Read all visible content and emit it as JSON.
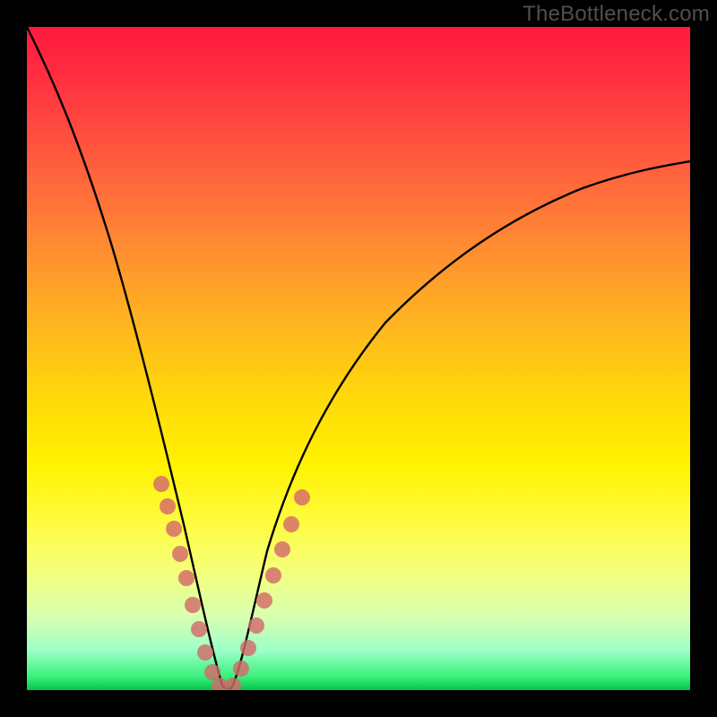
{
  "watermark": "TheBottleneck.com",
  "chart_data": {
    "type": "line",
    "title": "",
    "xlabel": "",
    "ylabel": "",
    "xlim": [
      0,
      100
    ],
    "ylim": [
      0,
      100
    ],
    "series": [
      {
        "name": "bottleneck-curve",
        "x": [
          0,
          5,
          10,
          15,
          18,
          20,
          22,
          24,
          26,
          28,
          29,
          30,
          31,
          32,
          34,
          36,
          40,
          45,
          50,
          55,
          60,
          65,
          70,
          75,
          80,
          85,
          90,
          95,
          100
        ],
        "y": [
          100,
          85,
          70,
          52,
          40,
          31,
          22,
          14,
          7,
          2,
          0.5,
          0,
          0.5,
          3,
          8,
          14,
          26,
          38,
          47,
          55,
          61,
          66,
          70,
          73,
          75,
          77,
          78.5,
          79.5,
          80
        ]
      },
      {
        "name": "marker-dots",
        "x": [
          20,
          21,
          22,
          23,
          24,
          25,
          26,
          27,
          28,
          29,
          31,
          32,
          33,
          34,
          35,
          36,
          37
        ],
        "y": [
          31,
          27,
          22,
          18,
          14,
          10,
          7,
          4,
          2,
          0.5,
          0.5,
          3,
          5.5,
          8,
          11,
          14,
          17
        ]
      }
    ],
    "background_gradient": {
      "top": "#ff1a3c",
      "middle": "#fff200",
      "bottom": "#06c24b"
    },
    "dot_color": "#d96b6b",
    "curve_color": "#000000"
  }
}
